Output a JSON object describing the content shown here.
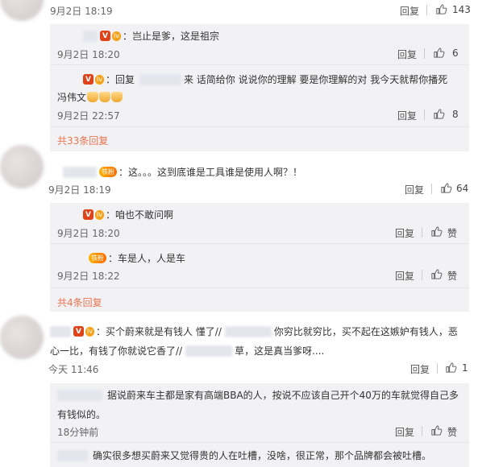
{
  "colors": {
    "accent": "#eb7350",
    "vip": "#e0421a",
    "reply_bg": "#f2f2f5"
  },
  "icons": {
    "like": "thumbs-up-icon",
    "vip": "v-badge-icon",
    "level": "level-badge-icon",
    "fan": "fan-badge-icon"
  },
  "ui": {
    "reply": "回复",
    "like_label": "赞"
  },
  "c1": {
    "time": "9月2日 18:19",
    "likes": "143"
  },
  "r1": {
    "text": "：岂止是爹，这是祖宗",
    "time": "9月2日 18:20",
    "likes": "6"
  },
  "r2": {
    "prefix": "：回复",
    "text": " 来 话简给你 说说你的理解 要是你理解的对 我今天就帮你播死",
    "text2": "冯伟文",
    "time": "9月2日 22:57",
    "likes": "8"
  },
  "c1_more": "共33条回复",
  "c2": {
    "badge": "铁粉",
    "text": "：这。。。这到底谁是工具谁是使用人啊？！",
    "time": "9月2日 18:19",
    "likes": "64"
  },
  "r3": {
    "text": "：咱也不敢问啊",
    "time": "9月2日 18:20"
  },
  "r4": {
    "badge": "铁粉",
    "text": "：车是人，人是车",
    "time": "9月2日 18:22"
  },
  "c2_more": "共4条回复",
  "c3": {
    "text1": "：买个蔚来就是有钱人 懂了//",
    "text2": "你穷比就穷比，买不起在这嫉妒有钱人，恶",
    "text3": "心一比，有钱了你就说它香了//",
    "text4": "草，这是真当爹呀....",
    "time": "今天 11:46",
    "likes": "1"
  },
  "r5": {
    "text1": "据说蔚来车主都是家有高端BBA的人，按说不应该自己开个40万的车就觉得自己多",
    "text2": "有钱似的。",
    "time": "18分钟前"
  },
  "r6": {
    "text": "确实很多想买蔚来又觉得贵的人在吐槽，没啥，很正常，那个品牌都会被吐槽。"
  }
}
